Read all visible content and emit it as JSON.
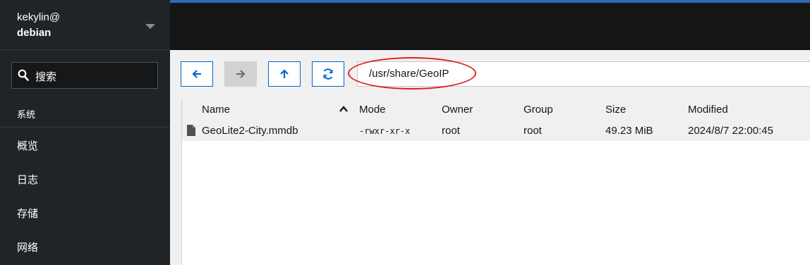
{
  "host": {
    "user": "kekylin@",
    "name": "debian"
  },
  "search": {
    "label": "搜索"
  },
  "sidebar": {
    "section_label": "系统",
    "items": [
      {
        "label": "概览"
      },
      {
        "label": "日志"
      },
      {
        "label": "存储"
      },
      {
        "label": "网络"
      }
    ]
  },
  "toolbar": {
    "back_icon": "arrow-left-icon",
    "forward_icon": "arrow-right-icon",
    "up_icon": "arrow-up-icon",
    "refresh_icon": "refresh-icon",
    "path": "/usr/share/GeoIP"
  },
  "table": {
    "columns": [
      "Name",
      "Mode",
      "Owner",
      "Group",
      "Size",
      "Modified"
    ],
    "sort_column": "Name",
    "sort_direction": "ascending",
    "rows": [
      {
        "name": "GeoLite2-City.mmdb",
        "mode": "-rwxr-xr-x",
        "owner": "root",
        "group": "root",
        "size": "49.23 MiB",
        "modified": "2024/8/7 22:00:45"
      }
    ]
  },
  "colors": {
    "sidebar_bg": "#212427",
    "accent": "#0066cc",
    "annotation": "#e02020",
    "topbar_bg": "#151515"
  }
}
